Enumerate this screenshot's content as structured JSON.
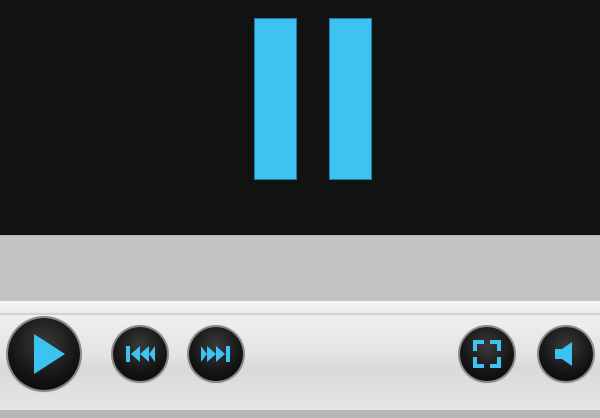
{
  "window": {
    "title": ""
  },
  "video": {
    "state": "paused",
    "overlay_icon": "pause-icon"
  },
  "controls": [
    {
      "name": "play-button",
      "icon": "play-icon"
    },
    {
      "name": "previous-button",
      "icon": "skip-back-icon"
    },
    {
      "name": "next-button",
      "icon": "skip-forward-icon"
    },
    {
      "name": "fullscreen-button",
      "icon": "fullscreen-icon"
    },
    {
      "name": "volume-button",
      "icon": "volume-icon"
    }
  ],
  "colors": {
    "accent": "#3cc3f1",
    "video_background": "#121212",
    "seek_area": "#c4c3c4",
    "button_fill": "#141414"
  }
}
